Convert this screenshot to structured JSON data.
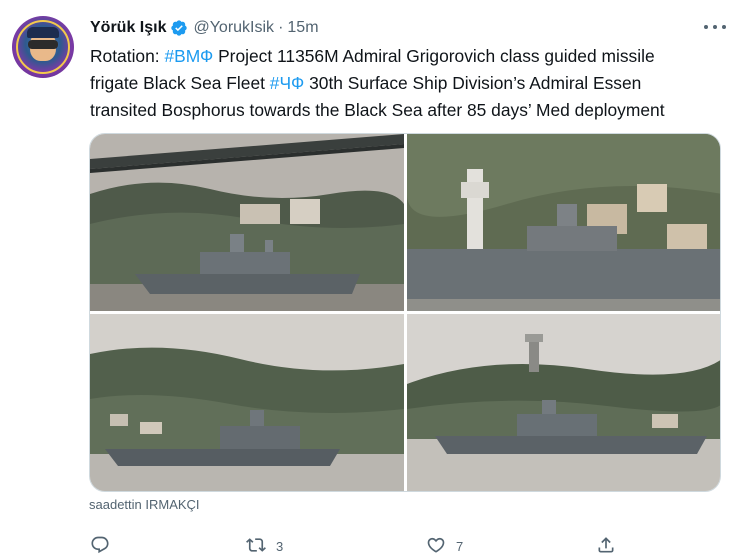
{
  "tweet": {
    "author": {
      "name": "Yörük Işık",
      "handle": "@YorukIsik",
      "separator": "·",
      "time": "15m"
    },
    "text": {
      "line1": [
        {
          "t": "Rotation: ",
          "tag": false
        },
        {
          "t": "#ВМФ",
          "tag": true
        },
        {
          "t": " Project 11356M Admiral Grigorovich class guided missile",
          "tag": false
        }
      ],
      "line2": [
        {
          "t": "frigate Black Sea Fleet ",
          "tag": false
        },
        {
          "t": "#ЧФ",
          "tag": true
        },
        {
          "t": " 30th Surface Ship Division’s Admiral Essen",
          "tag": false
        }
      ],
      "line3": [
        {
          "t": "transited Bosphorus towards the Black Sea after 85 days’ Med deployment",
          "tag": false
        }
      ]
    },
    "media_credit": "saadettin IRMAKÇI",
    "actions": {
      "reply_count": "",
      "retweet_count": "3",
      "like_count": "7"
    }
  },
  "colors": {
    "accent": "#1d9bf0",
    "secondary_text": "#536471",
    "border": "#cfd9de"
  },
  "icons": [
    "verified-badge-icon",
    "more-icon",
    "reply-icon",
    "retweet-icon",
    "like-icon",
    "share-icon"
  ]
}
